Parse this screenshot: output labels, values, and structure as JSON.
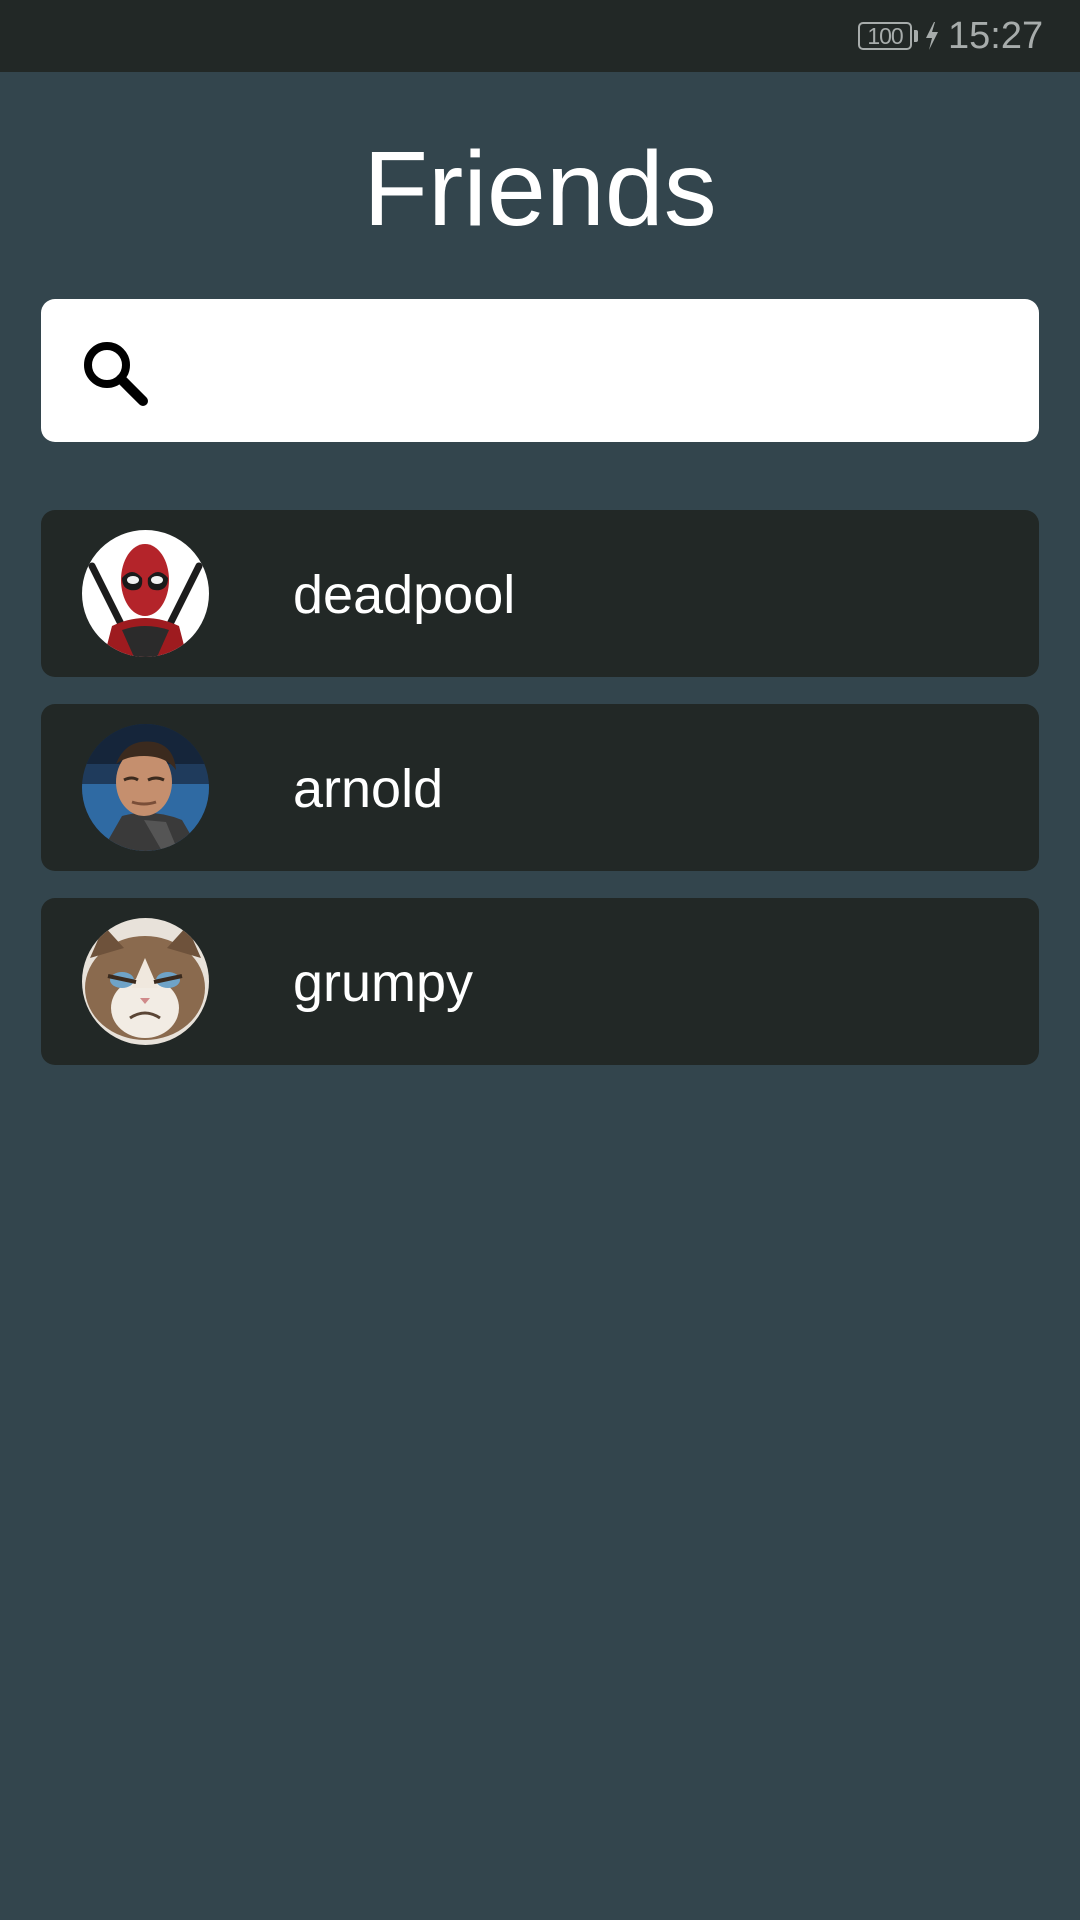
{
  "status_bar": {
    "battery_level": "100",
    "charging": true,
    "time": "15:27",
    "icons": [
      "battery-icon",
      "charging-bolt-icon"
    ]
  },
  "header": {
    "title": "Friends"
  },
  "search": {
    "value": "",
    "placeholder": "",
    "icon": "search-icon"
  },
  "friends": [
    {
      "name": "deadpool",
      "avatar": "deadpool-avatar"
    },
    {
      "name": "arnold",
      "avatar": "arnold-avatar"
    },
    {
      "name": "grumpy",
      "avatar": "grumpy-cat-avatar"
    }
  ],
  "colors": {
    "background": "#33454d",
    "status_bar": "#222826",
    "row_background": "#222826",
    "search_background": "#ffffff",
    "text": "#ffffff",
    "status_text": "#a7acab"
  }
}
